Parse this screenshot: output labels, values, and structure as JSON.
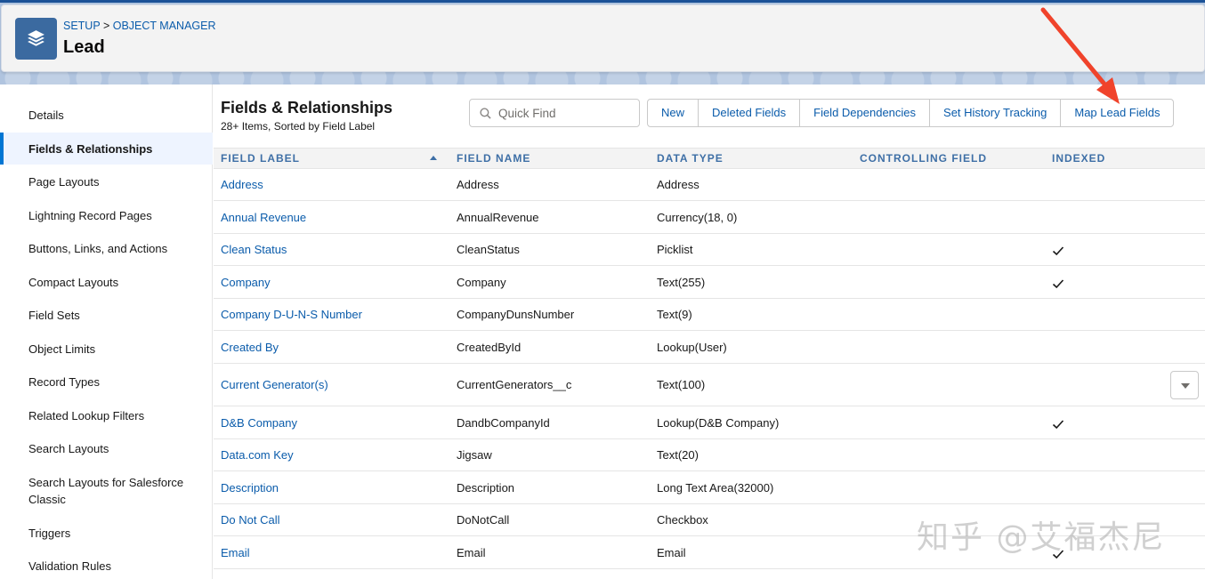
{
  "header": {
    "breadcrumb": [
      "SETUP",
      "OBJECT MANAGER"
    ],
    "breadcrumb_sep": ">",
    "title": "Lead",
    "icon": "stacked-layers-icon"
  },
  "sidebar": {
    "items": [
      {
        "label": "Details"
      },
      {
        "label": "Fields & Relationships",
        "active": true
      },
      {
        "label": "Page Layouts"
      },
      {
        "label": "Lightning Record Pages"
      },
      {
        "label": "Buttons, Links, and Actions"
      },
      {
        "label": "Compact Layouts"
      },
      {
        "label": "Field Sets"
      },
      {
        "label": "Object Limits"
      },
      {
        "label": "Record Types"
      },
      {
        "label": "Related Lookup Filters"
      },
      {
        "label": "Search Layouts"
      },
      {
        "label": "Search Layouts for Salesforce Classic"
      },
      {
        "label": "Triggers"
      },
      {
        "label": "Validation Rules"
      }
    ]
  },
  "content": {
    "title": "Fields & Relationships",
    "subtitle": "28+ Items, Sorted by Field Label",
    "search": {
      "placeholder": "Quick Find",
      "value": ""
    },
    "buttons": [
      "New",
      "Deleted Fields",
      "Field Dependencies",
      "Set History Tracking",
      "Map Lead Fields"
    ],
    "columns": [
      "FIELD LABEL",
      "FIELD NAME",
      "DATA TYPE",
      "CONTROLLING FIELD",
      "INDEXED"
    ],
    "rows": [
      {
        "label": "Address",
        "name": "Address",
        "type": "Address",
        "controlling": "",
        "indexed": false
      },
      {
        "label": "Annual Revenue",
        "name": "AnnualRevenue",
        "type": "Currency(18, 0)",
        "controlling": "",
        "indexed": false
      },
      {
        "label": "Clean Status",
        "name": "CleanStatus",
        "type": "Picklist",
        "controlling": "",
        "indexed": true
      },
      {
        "label": "Company",
        "name": "Company",
        "type": "Text(255)",
        "controlling": "",
        "indexed": true
      },
      {
        "label": "Company D-U-N-S Number",
        "name": "CompanyDunsNumber",
        "type": "Text(9)",
        "controlling": "",
        "indexed": false
      },
      {
        "label": "Created By",
        "name": "CreatedById",
        "type": "Lookup(User)",
        "controlling": "",
        "indexed": false
      },
      {
        "label": "Current Generator(s)",
        "name": "CurrentGenerators__c",
        "type": "Text(100)",
        "controlling": "",
        "indexed": false,
        "has_menu": true
      },
      {
        "label": "D&B Company",
        "name": "DandbCompanyId",
        "type": "Lookup(D&B Company)",
        "controlling": "",
        "indexed": true
      },
      {
        "label": "Data.com Key",
        "name": "Jigsaw",
        "type": "Text(20)",
        "controlling": "",
        "indexed": false
      },
      {
        "label": "Description",
        "name": "Description",
        "type": "Long Text Area(32000)",
        "controlling": "",
        "indexed": false
      },
      {
        "label": "Do Not Call",
        "name": "DoNotCall",
        "type": "Checkbox",
        "controlling": "",
        "indexed": false
      },
      {
        "label": "Email",
        "name": "Email",
        "type": "Email",
        "controlling": "",
        "indexed": true
      }
    ]
  },
  "watermark": "知乎 @艾福杰尼",
  "colors": {
    "link": "#0b5cab",
    "header_icon": "#3b6aa0",
    "annotation_arrow": "#f0432b",
    "active_bar": "#0176d3"
  }
}
